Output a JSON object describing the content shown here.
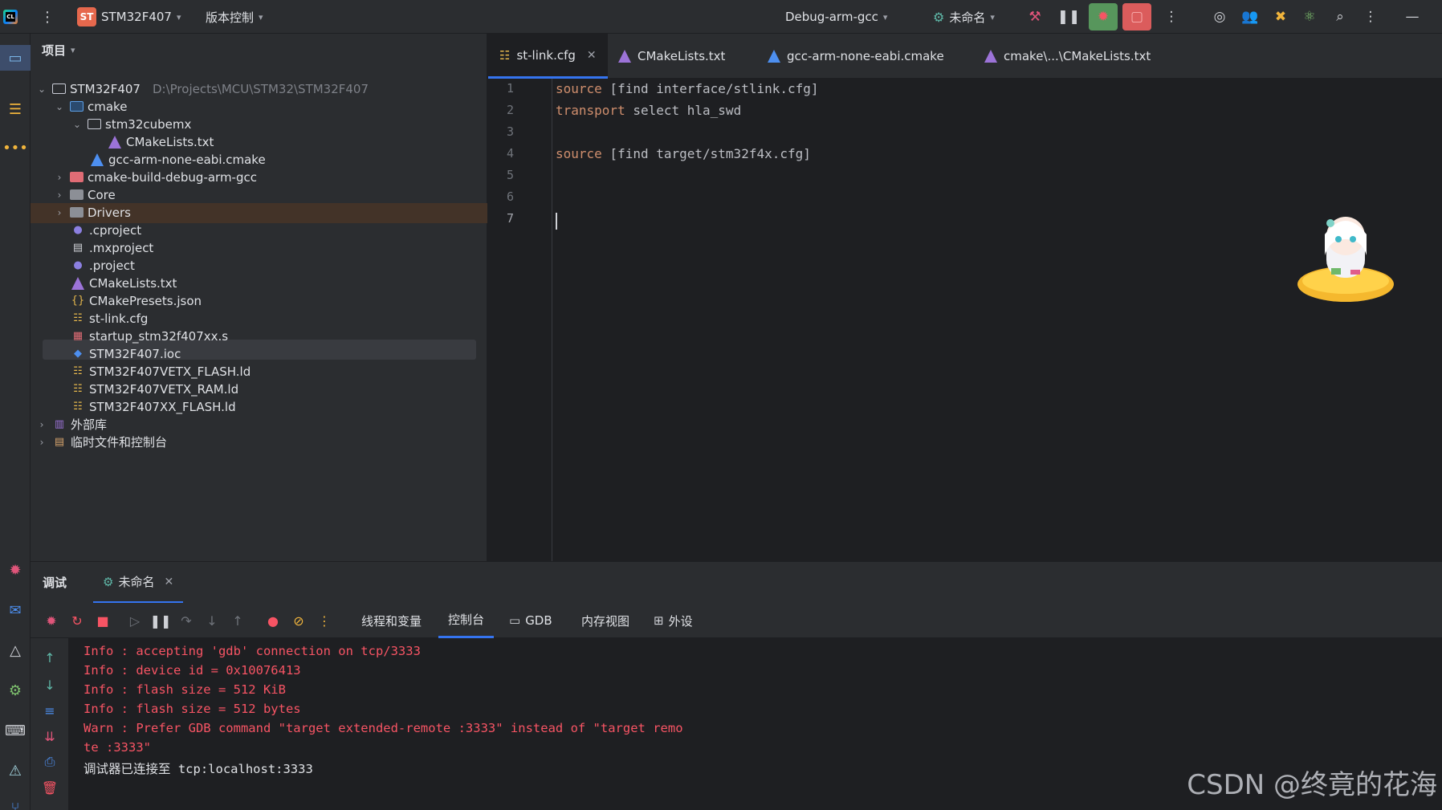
{
  "titlebar": {
    "project_badge": "ST",
    "project_name": "STM32F407",
    "vcs_label": "版本控制",
    "run_config": "Debug-arm-gcc",
    "debug_target": "未命名"
  },
  "project_panel": {
    "title": "项目",
    "tree": [
      {
        "label": "STM32F407",
        "hint": "D:\\Projects\\MCU\\STM32\\STM32F407"
      },
      {
        "label": "cmake"
      },
      {
        "label": "stm32cubemx"
      },
      {
        "label": "CMakeLists.txt"
      },
      {
        "label": "gcc-arm-none-eabi.cmake"
      },
      {
        "label": "cmake-build-debug-arm-gcc"
      },
      {
        "label": "Core"
      },
      {
        "label": "Drivers"
      },
      {
        "label": ".cproject"
      },
      {
        "label": ".mxproject"
      },
      {
        "label": ".project"
      },
      {
        "label": "CMakeLists.txt"
      },
      {
        "label": "CMakePresets.json"
      },
      {
        "label": "st-link.cfg"
      },
      {
        "label": "startup_stm32f407xx.s"
      },
      {
        "label": "STM32F407.ioc"
      },
      {
        "label": "STM32F407VETX_FLASH.ld"
      },
      {
        "label": "STM32F407VETX_RAM.ld"
      },
      {
        "label": "STM32F407XX_FLASH.ld"
      },
      {
        "label": "外部库"
      },
      {
        "label": "临时文件和控制台"
      }
    ]
  },
  "editor": {
    "tabs": [
      {
        "label": "st-link.cfg"
      },
      {
        "label": "CMakeLists.txt"
      },
      {
        "label": "gcc-arm-none-eabi.cmake"
      },
      {
        "label": "cmake\\...\\CMakeLists.txt"
      }
    ],
    "line_numbers": [
      "1",
      "2",
      "3",
      "4",
      "5",
      "6",
      "7"
    ],
    "lines": [
      {
        "kw": "source",
        "rest": " [find interface/stlink.cfg]"
      },
      {
        "kw": "transport",
        "rest": " select hla_swd"
      },
      {
        "kw": "",
        "rest": ""
      },
      {
        "kw": "source",
        "rest": " [find target/stm32f4x.cfg]"
      },
      {
        "kw": "",
        "rest": ""
      },
      {
        "kw": "",
        "rest": ""
      },
      {
        "kw": "",
        "rest": ""
      }
    ]
  },
  "debug": {
    "title": "调试",
    "session_tab": "未命名",
    "subtabs": [
      "线程和变量",
      "控制台",
      "GDB",
      "内存视图",
      "外设"
    ],
    "console_lines": [
      "Info : accepting 'gdb' connection on tcp/3333",
      "Info : device id = 0x10076413",
      "Info : flash size = 512 KiB",
      "Info : flash size = 512 bytes",
      "Warn : Prefer GDB command \"target extended-remote :3333\" instead of \"target remo",
      "te :3333\"",
      "调试器已连接至 tcp:localhost:3333"
    ]
  },
  "watermark": "CSDN @终竟的花海",
  "colors": {
    "accent": "#3574f0",
    "keyword": "#cf8e6d",
    "console_error": "#f75464",
    "highlight_row": "#433328"
  }
}
